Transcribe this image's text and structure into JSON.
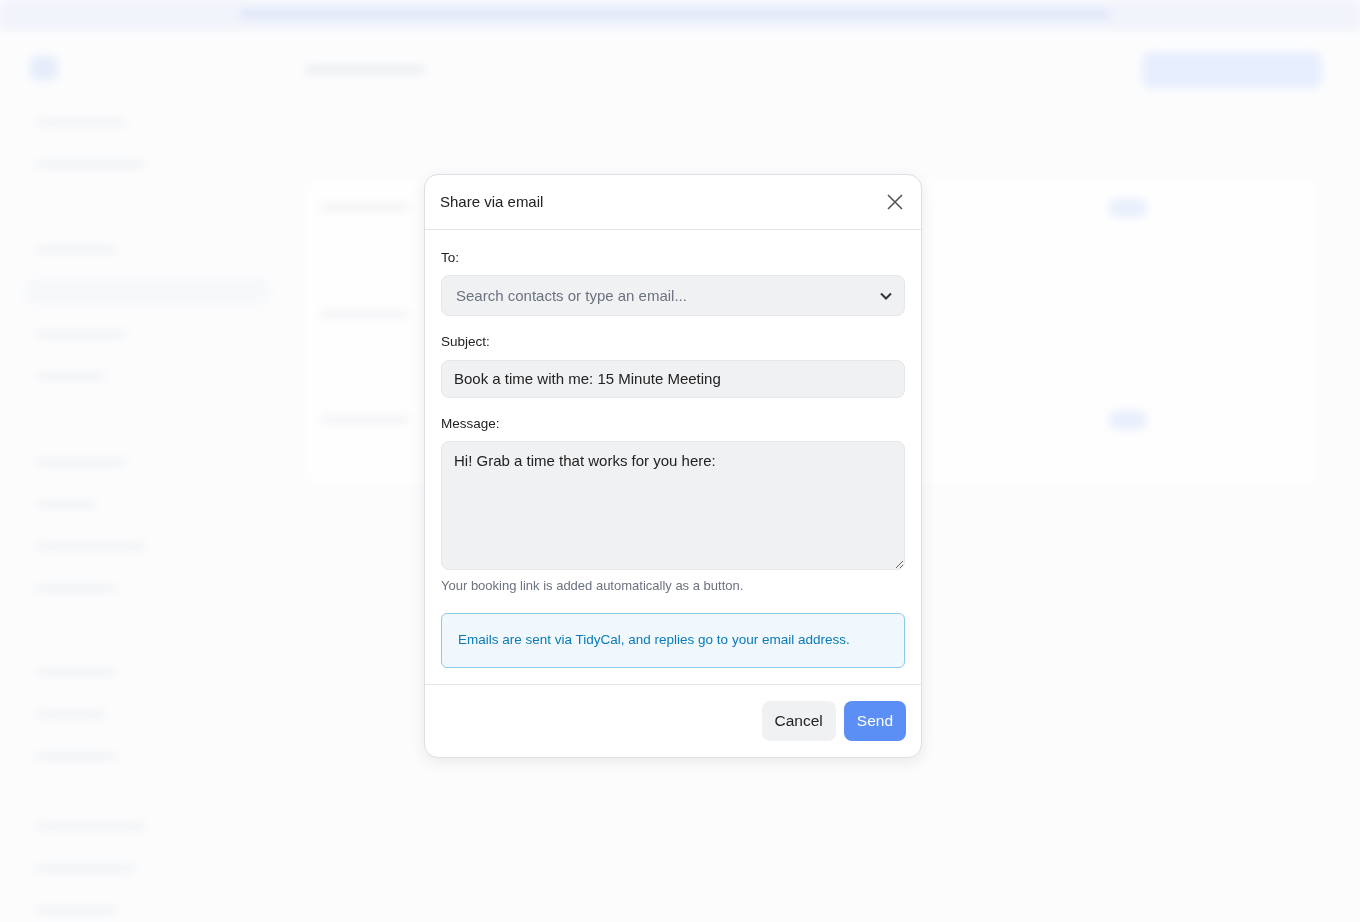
{
  "dialog": {
    "title": "Share via email",
    "fields": [
      {
        "kind": "select",
        "label": "To:",
        "placeholder": "Search contacts or type an email..."
      },
      {
        "kind": "text",
        "label": "Subject:",
        "value": "Book a time with me: 15 Minute Meeting"
      },
      {
        "kind": "textarea",
        "label": "Message:",
        "value": "Hi! Grab a time that works for you here:",
        "help": "Your booking link is added automatically as a button."
      }
    ],
    "info": "Emails are sent via TidyCal, and replies go to your email address.",
    "buttons": [
      {
        "label": "Cancel",
        "kind": "secondary"
      },
      {
        "label": "Send",
        "kind": "primary"
      }
    ]
  }
}
